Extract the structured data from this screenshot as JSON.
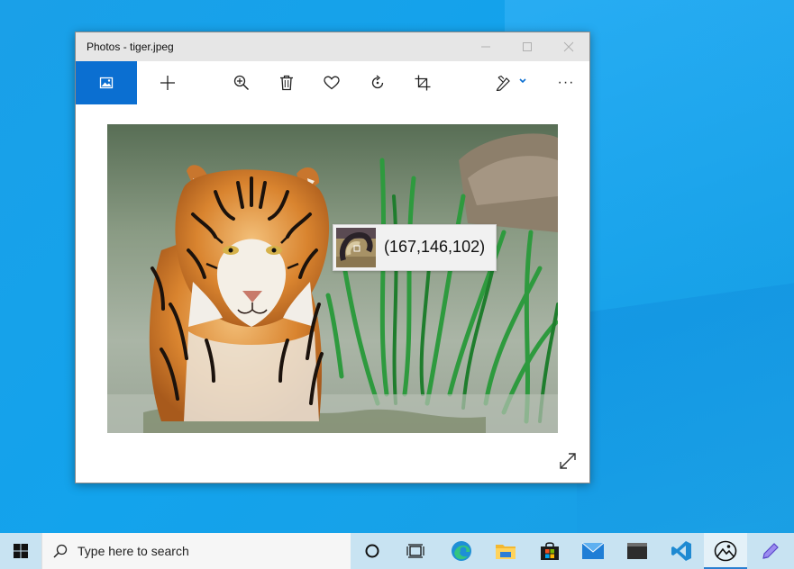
{
  "window": {
    "title": "Photos - tiger.jpeg",
    "controls": {
      "minimize": "—",
      "maximize": "☐",
      "close": "✕"
    }
  },
  "toolbar": {
    "items": [
      "home-image-icon",
      "add-icon",
      "zoom-in-icon",
      "delete-icon",
      "favorite-icon",
      "rotate-icon",
      "crop-icon",
      "edit-icon",
      "more-icon"
    ],
    "more_label": "···"
  },
  "color_picker": {
    "value": "(167,146,102)"
  },
  "taskbar": {
    "search_placeholder": "Type here to search",
    "apps": [
      "task-view-circle-icon",
      "timeline-icon",
      "edge-icon",
      "file-explorer-icon",
      "store-icon",
      "mail-icon",
      "terminal-icon",
      "vscode-icon",
      "photos-icon",
      "pen-icon"
    ]
  },
  "colors": {
    "accent": "#0b6fd1",
    "desktop": "#13a3ec",
    "taskbar": "#c8e3f2"
  }
}
